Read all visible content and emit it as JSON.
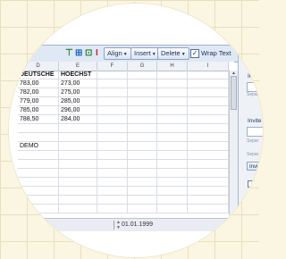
{
  "toolbar": {
    "align_label": "Align",
    "insert_label": "Insert",
    "delete_label": "Delete",
    "wrap_text_label": "Wrap Text",
    "wrap_text_checked": "✓",
    "icons": [
      "insert-row-icon",
      "insert-col-icon",
      "merge-cells-icon",
      "clear-format-icon"
    ]
  },
  "sheet": {
    "columns": [
      "D",
      "E",
      "F",
      "G",
      "H",
      "I"
    ],
    "rows": [
      [
        "DEUTSCHE",
        "HOECHST",
        "",
        "",
        "",
        ""
      ],
      [
        "783,00",
        "273,00",
        "",
        "",
        "",
        ""
      ],
      [
        "782,00",
        "275,00",
        "",
        "",
        "",
        ""
      ],
      [
        "779,00",
        "285,00",
        "",
        "",
        "",
        ""
      ],
      [
        "785,00",
        "296,00",
        "",
        "",
        "",
        ""
      ],
      [
        "788,50",
        "284,00",
        "",
        "",
        "",
        ""
      ],
      [
        "",
        "",
        "",
        "",
        "",
        ""
      ],
      [
        "",
        "",
        "",
        "",
        "",
        ""
      ],
      [
        "DEMO",
        "",
        "",
        "",
        "",
        ""
      ],
      [
        "",
        "",
        "",
        "",
        "",
        ""
      ],
      [
        "",
        "",
        "",
        "",
        "",
        ""
      ],
      [
        "",
        "",
        "",
        "",
        "",
        ""
      ],
      [
        "",
        "",
        "",
        "",
        "",
        ""
      ],
      [
        "",
        "",
        "",
        "",
        "",
        ""
      ],
      [
        "",
        "",
        "",
        "",
        "",
        ""
      ],
      [
        "",
        "",
        "",
        "",
        "",
        ""
      ]
    ]
  },
  "side_panel": {
    "label_1": "In",
    "sep_1": "Separ",
    "label_2": "Invite",
    "sep_2": "Separ",
    "sep_3": "Separ",
    "button_label": "Invi"
  },
  "status_bar": {
    "date": "01.01.1999"
  }
}
